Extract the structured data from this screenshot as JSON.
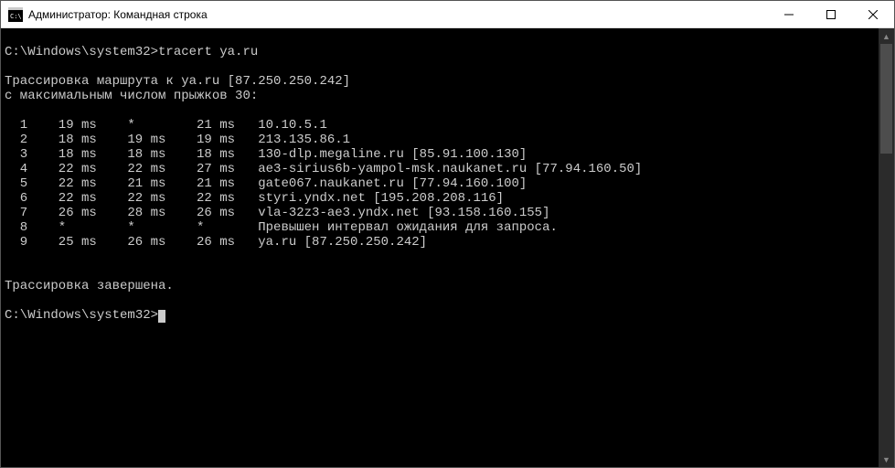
{
  "window": {
    "title": "Администратор: Командная строка"
  },
  "prompts": {
    "p1": "C:\\Windows\\system32>",
    "cmd1": "tracert ya.ru",
    "p2": "C:\\Windows\\system32>"
  },
  "trace": {
    "header1": "Трассировка маршрута к ya.ru [87.250.250.242]",
    "header2": "с максимальным числом прыжков 30:",
    "footer": "Трассировка завершена."
  },
  "hops": [
    {
      "n": "1",
      "t1": "19 ms",
      "t2": "*    ",
      "t3": "21 ms",
      "host": "10.10.5.1"
    },
    {
      "n": "2",
      "t1": "18 ms",
      "t2": "19 ms",
      "t3": "19 ms",
      "host": "213.135.86.1"
    },
    {
      "n": "3",
      "t1": "18 ms",
      "t2": "18 ms",
      "t3": "18 ms",
      "host": "130-dlp.megaline.ru [85.91.100.130]"
    },
    {
      "n": "4",
      "t1": "22 ms",
      "t2": "22 ms",
      "t3": "27 ms",
      "host": "ae3-sirius6b-yampol-msk.naukanet.ru [77.94.160.50]"
    },
    {
      "n": "5",
      "t1": "22 ms",
      "t2": "21 ms",
      "t3": "21 ms",
      "host": "gate067.naukanet.ru [77.94.160.100]"
    },
    {
      "n": "6",
      "t1": "22 ms",
      "t2": "22 ms",
      "t3": "22 ms",
      "host": "styri.yndx.net [195.208.208.116]"
    },
    {
      "n": "7",
      "t1": "26 ms",
      "t2": "28 ms",
      "t3": "26 ms",
      "host": "vla-32z3-ae3.yndx.net [93.158.160.155]"
    },
    {
      "n": "8",
      "t1": "*    ",
      "t2": "*    ",
      "t3": "*    ",
      "host": "Превышен интервал ожидания для запроса."
    },
    {
      "n": "9",
      "t1": "25 ms",
      "t2": "26 ms",
      "t3": "26 ms",
      "host": "ya.ru [87.250.250.242]"
    }
  ]
}
